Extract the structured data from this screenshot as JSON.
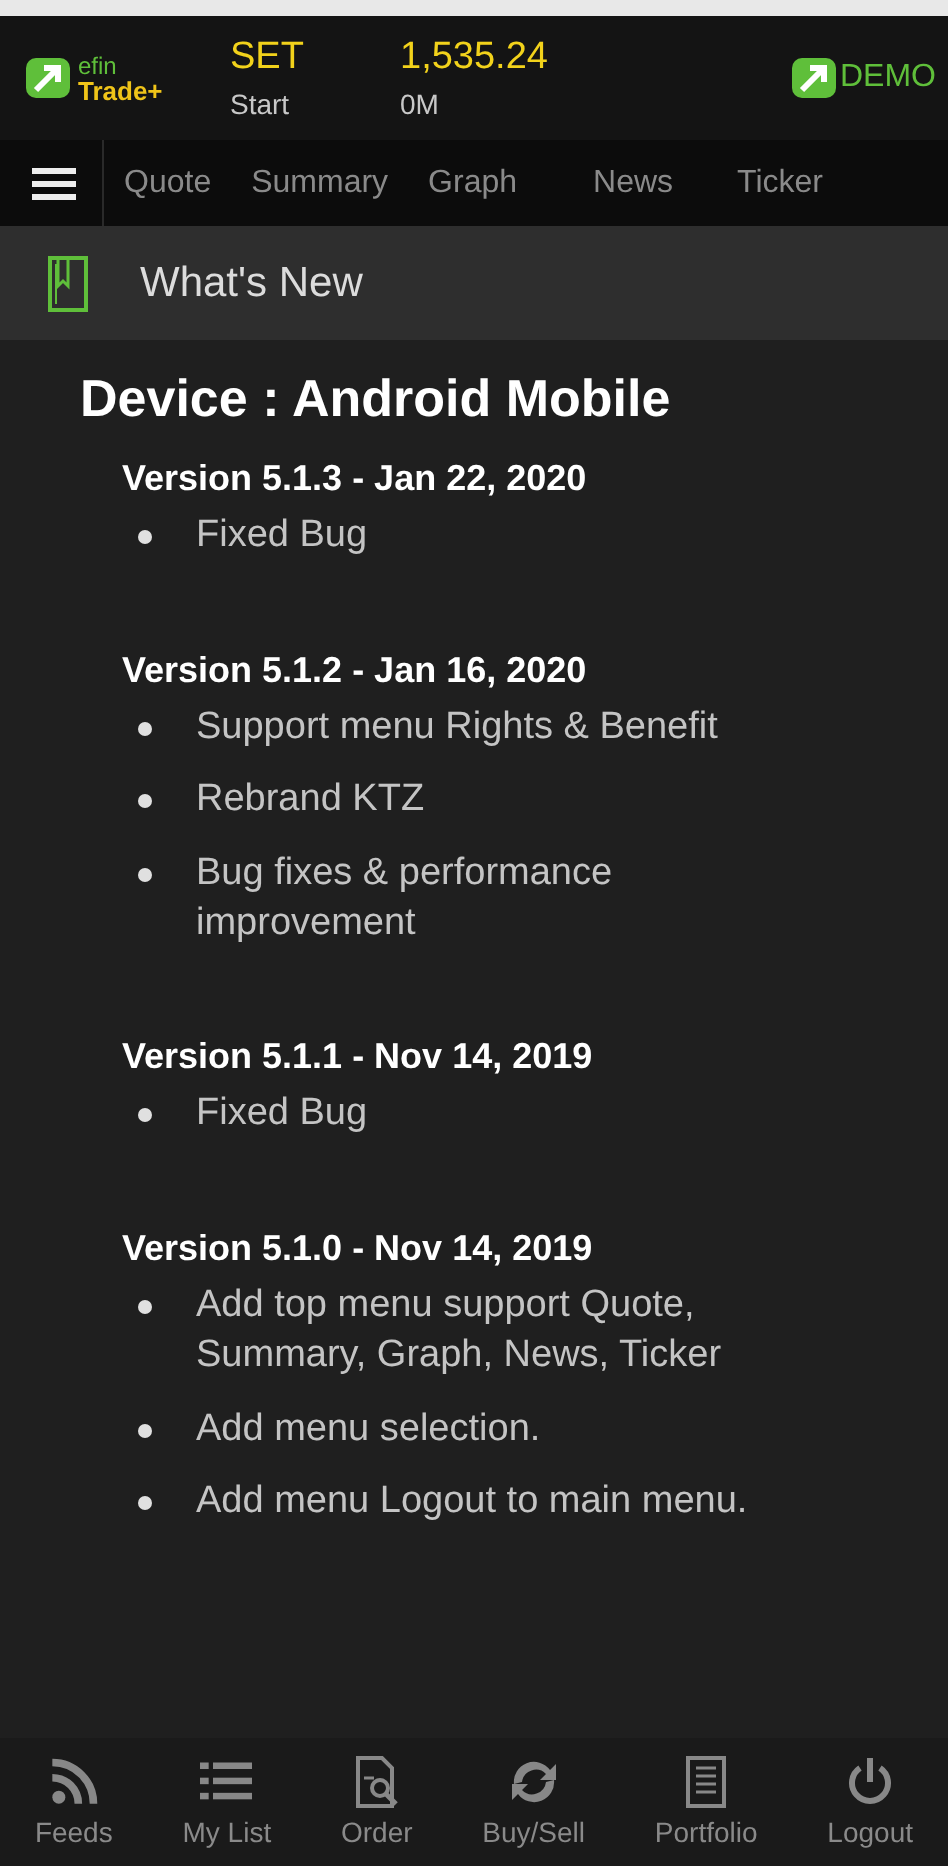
{
  "header": {
    "brand_top": "efin",
    "brand_bottom": "Trade+",
    "index_name": "SET",
    "index_value": "1,535.24",
    "market_status": "Start",
    "volume": "0M",
    "mode": "DEMO"
  },
  "top_menu": [
    "Quote",
    "Summary",
    "Graph",
    "News",
    "Ticker"
  ],
  "page_title": "What's New",
  "device": "Device : Android Mobile",
  "versions": [
    {
      "title": "Version 5.1.3 - Jan 22, 2020",
      "items": [
        "Fixed Bug"
      ]
    },
    {
      "title": "Version 5.1.2 - Jan 16, 2020",
      "items": [
        "Support menu Rights & Benefit",
        "Rebrand KTZ",
        "Bug fixes & performance improvement"
      ]
    },
    {
      "title": "Version 5.1.1 - Nov 14, 2019",
      "items": [
        "Fixed Bug"
      ]
    },
    {
      "title": "Version 5.1.0 - Nov 14, 2019",
      "items": [
        "Add top menu support Quote, Summary, Graph, News, Ticker",
        "Add menu selection.",
        "Add menu Logout to main menu."
      ]
    }
  ],
  "bottom_nav": [
    {
      "kind": "feeds",
      "label": "Feeds"
    },
    {
      "kind": "list",
      "label": "My List"
    },
    {
      "kind": "order",
      "label": "Order"
    },
    {
      "kind": "exchange",
      "label": "Buy/Sell"
    },
    {
      "kind": "portfolio",
      "label": "Portfolio"
    },
    {
      "kind": "power",
      "label": "Logout"
    }
  ]
}
